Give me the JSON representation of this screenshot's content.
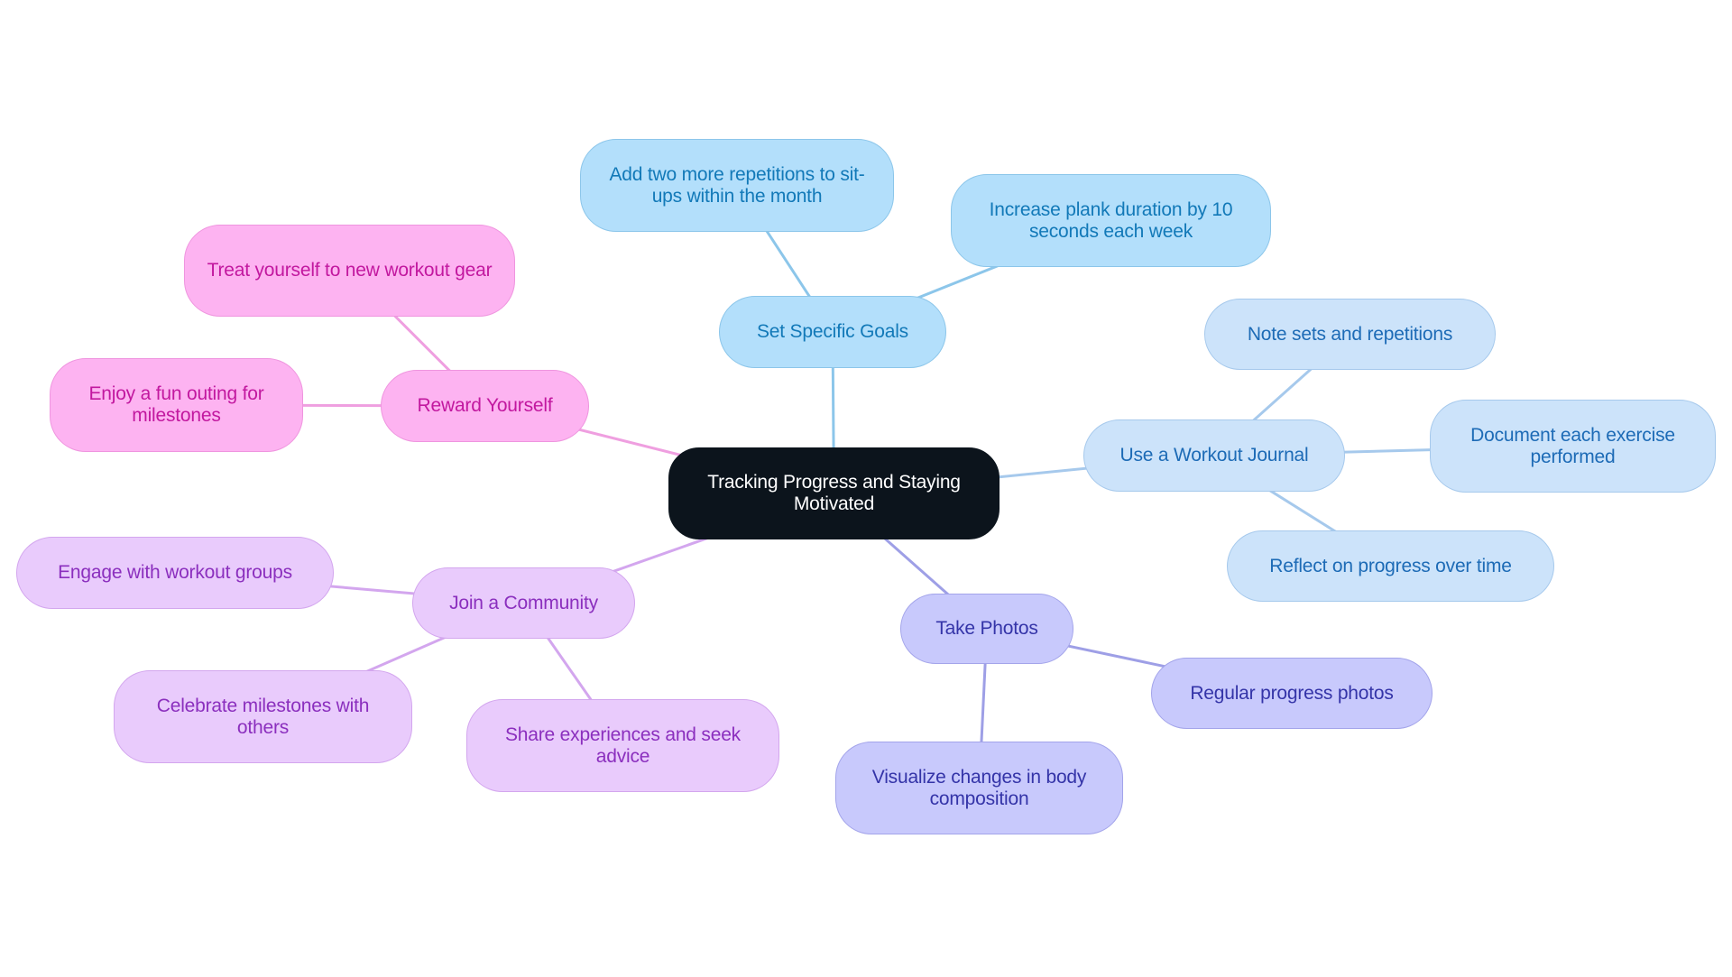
{
  "diagram": {
    "type": "mind-map",
    "root": {
      "id": "root",
      "label": "Tracking Progress and Staying Motivated"
    },
    "branches": [
      {
        "id": "goals",
        "label": "Set Specific Goals",
        "theme": "goals",
        "edge_color": "#8cc6ea",
        "children": [
          {
            "id": "goals-1",
            "label": "Add two more repetitions to sit-ups within the month"
          },
          {
            "id": "goals-2",
            "label": "Increase plank duration by 10 seconds each week"
          }
        ]
      },
      {
        "id": "journal",
        "label": "Use a Workout Journal",
        "theme": "journal",
        "edge_color": "#a6c9ec",
        "children": [
          {
            "id": "journal-1",
            "label": "Note sets and repetitions"
          },
          {
            "id": "journal-2",
            "label": "Document each exercise performed"
          },
          {
            "id": "journal-3",
            "label": "Reflect on progress over time"
          }
        ]
      },
      {
        "id": "photos",
        "label": "Take Photos",
        "theme": "photos",
        "edge_color": "#9e9fe6",
        "children": [
          {
            "id": "photos-1",
            "label": "Regular progress photos"
          },
          {
            "id": "photos-2",
            "label": "Visualize changes in body composition"
          }
        ]
      },
      {
        "id": "community",
        "label": "Join a Community",
        "theme": "community",
        "edge_color": "#d3a6ee",
        "children": [
          {
            "id": "community-1",
            "label": "Engage with workout groups"
          },
          {
            "id": "community-2",
            "label": "Celebrate milestones with others"
          },
          {
            "id": "community-3",
            "label": "Share experiences and seek advice"
          }
        ]
      },
      {
        "id": "reward",
        "label": "Reward Yourself",
        "theme": "reward",
        "edge_color": "#ef9fe0",
        "children": [
          {
            "id": "reward-1",
            "label": "Treat yourself to new workout gear"
          },
          {
            "id": "reward-2",
            "label": "Enjoy a fun outing for milestones"
          }
        ]
      }
    ]
  }
}
